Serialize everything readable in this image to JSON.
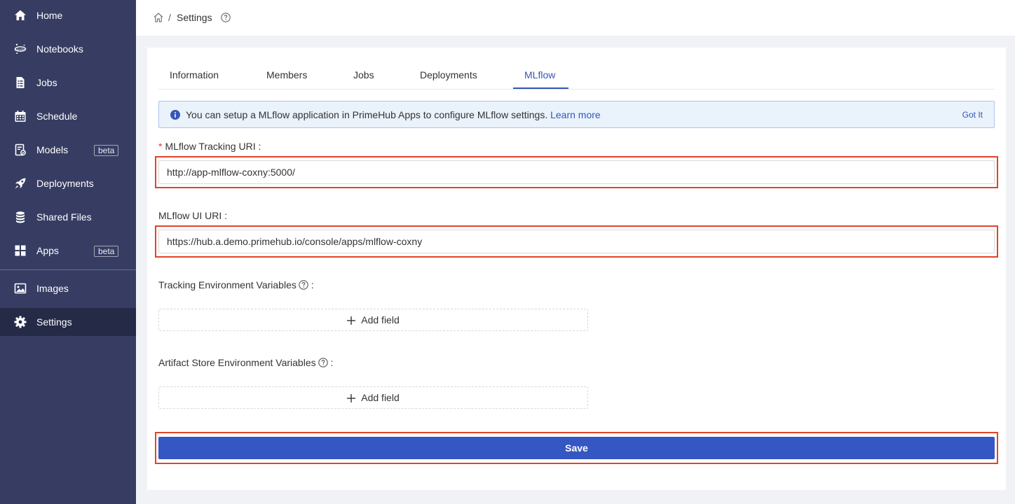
{
  "sidebar": {
    "items": [
      {
        "label": "Home",
        "icon": "home-icon"
      },
      {
        "label": "Notebooks",
        "icon": "jupyter-icon"
      },
      {
        "label": "Jobs",
        "icon": "file-icon"
      },
      {
        "label": "Schedule",
        "icon": "calendar-icon"
      },
      {
        "label": "Models",
        "icon": "model-icon",
        "badge": "beta"
      },
      {
        "label": "Deployments",
        "icon": "rocket-icon"
      },
      {
        "label": "Shared Files",
        "icon": "database-icon"
      },
      {
        "label": "Apps",
        "icon": "apps-grid-icon",
        "badge": "beta"
      },
      {
        "label": "Images",
        "icon": "image-icon"
      },
      {
        "label": "Settings",
        "icon": "gear-icon",
        "active": true
      }
    ]
  },
  "breadcrumb": {
    "separator": "/",
    "title": "Settings"
  },
  "tabs": [
    {
      "label": "Information"
    },
    {
      "label": "Members"
    },
    {
      "label": "Jobs"
    },
    {
      "label": "Deployments"
    },
    {
      "label": "MLflow",
      "active": true
    }
  ],
  "alert": {
    "text": "You can setup a MLflow application in PrimeHub Apps to configure MLflow settings. ",
    "link": "Learn more",
    "close": "Got It"
  },
  "form": {
    "tracking_uri": {
      "label": "MLflow Tracking URI",
      "value": "http://app-mlflow-coxny:5000/",
      "required": true
    },
    "ui_uri": {
      "label": "MLflow UI URI",
      "value": "https://hub.a.demo.primehub.io/console/apps/mlflow-coxny"
    },
    "tracking_env": {
      "label": "Tracking Environment Variables",
      "add_label": "Add field"
    },
    "artifact_env": {
      "label": "Artifact Store Environment Variables",
      "add_label": "Add field"
    },
    "colon": ":",
    "save_label": "Save"
  },
  "colors": {
    "sidebar_bg": "#373d62",
    "sidebar_active": "#252a47",
    "accent": "#3557b7",
    "save_button": "#3557c3",
    "highlight_box": "#e2432a"
  }
}
